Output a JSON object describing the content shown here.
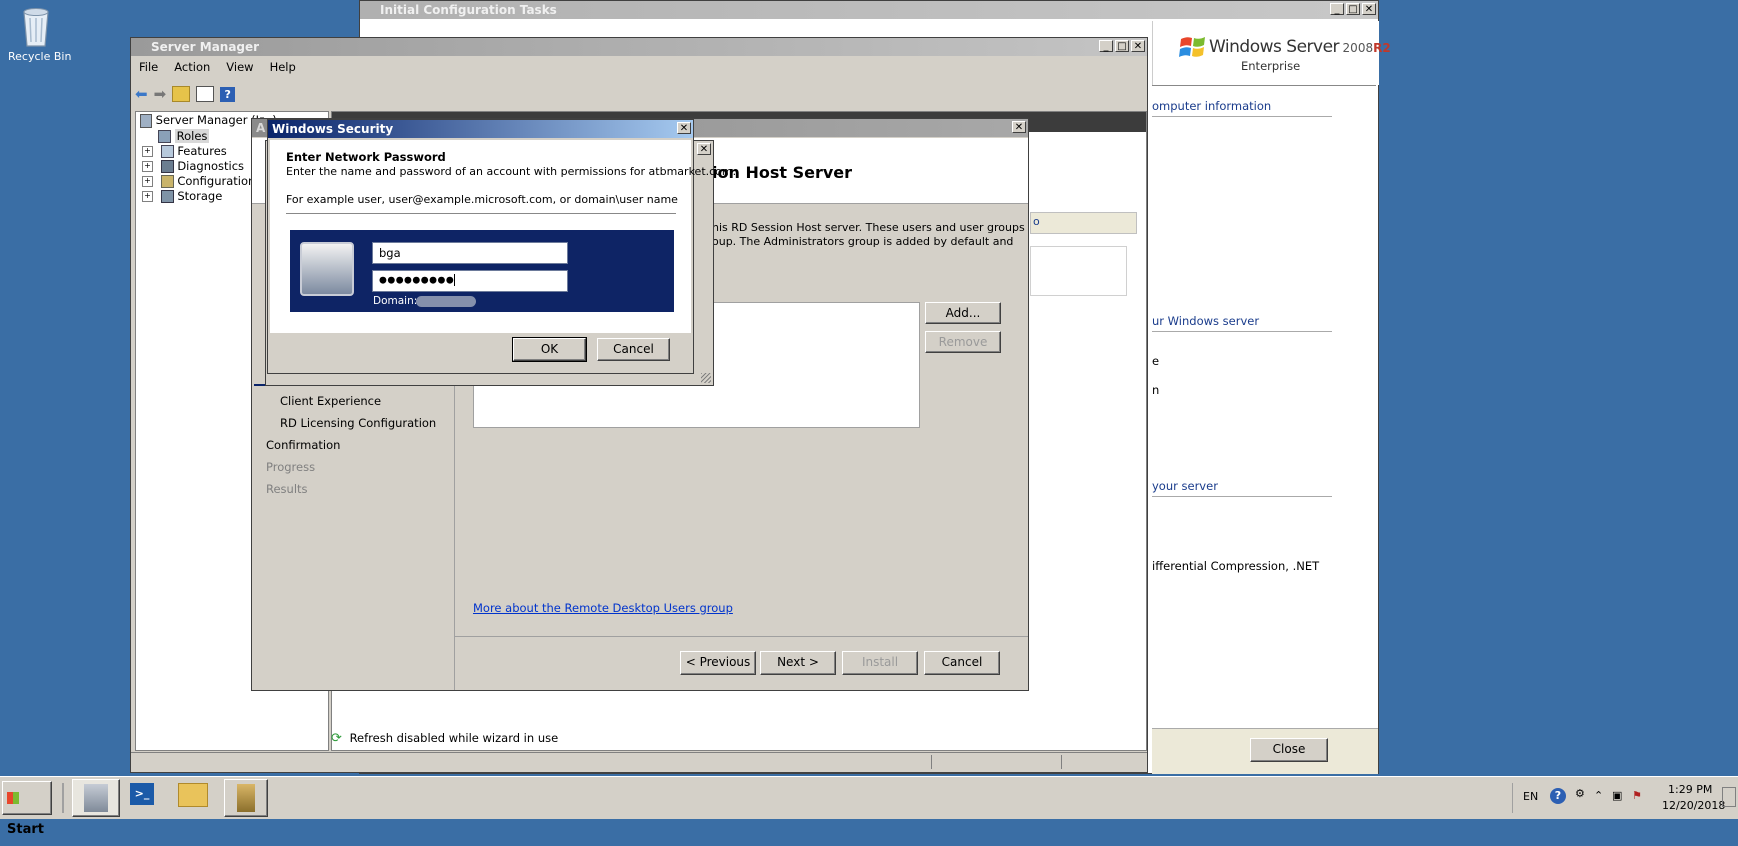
{
  "desktop": {
    "recycle_bin_label": "Recycle Bin"
  },
  "ict": {
    "title": "Initial Configuration Tasks",
    "brand_line1": "Windows Server",
    "brand_year": "2008",
    "brand_r2": "R2",
    "brand_edition": "Enterprise",
    "section1": "omputer information",
    "section2": "ur Windows server",
    "frag_e": "e",
    "frag_n": "n",
    "section3": "your server",
    "features_text": "ifferential Compression, .NET",
    "close_label": "Close"
  },
  "server_manager": {
    "title": "Server Manager",
    "menu": [
      "File",
      "Action",
      "View",
      "Help"
    ],
    "tree": {
      "root": "Server Manager (Iᴇ    )",
      "roles": "Roles",
      "features": "Features",
      "diagnostics": "Diagnostics",
      "configuration": "Configuration",
      "storage": "Storage"
    },
    "status_text": "Refresh disabled while wizard in use"
  },
  "wizard": {
    "title_fragment": "A",
    "heading_fragment": "ion Host Server",
    "desc_line1": "his RD Session Host server. These users and user groups",
    "desc_line2": "oup. The Administrators group is added by default and",
    "tab_fragment": "o",
    "nav": {
      "client_experience": "Client Experience",
      "rd_licensing": "RD Licensing Configuration",
      "confirmation": "Confirmation",
      "progress": "Progress",
      "results": "Results"
    },
    "add_label": "Add...",
    "remove_label": "Remove",
    "more_link": "More about the Remote Desktop Users group",
    "prev_label": "< Previous",
    "next_label": "Next >",
    "install_label": "Install",
    "cancel_label": "Cancel"
  },
  "security_dialog": {
    "title": "Windows Security",
    "heading": "Enter Network Password",
    "instruction": "Enter the name and password of an account with permissions for atbmarket.com.",
    "example": "For example user, user@example.microsoft.com, or domain\\user name",
    "username_value": "bga",
    "password_mask": "●●●●●●●●●",
    "domain_label": "Domain:",
    "ok_label": "OK",
    "cancel_label": "Cancel"
  },
  "taskbar": {
    "start_label": "Start",
    "lang": "EN",
    "time": "1:29 PM",
    "date": "12/20/2018"
  },
  "colors": {
    "desktop": "#3a6ea5",
    "title_active": "#0a246a",
    "dialog_banner": "#0e2465",
    "link": "#0033cc"
  }
}
